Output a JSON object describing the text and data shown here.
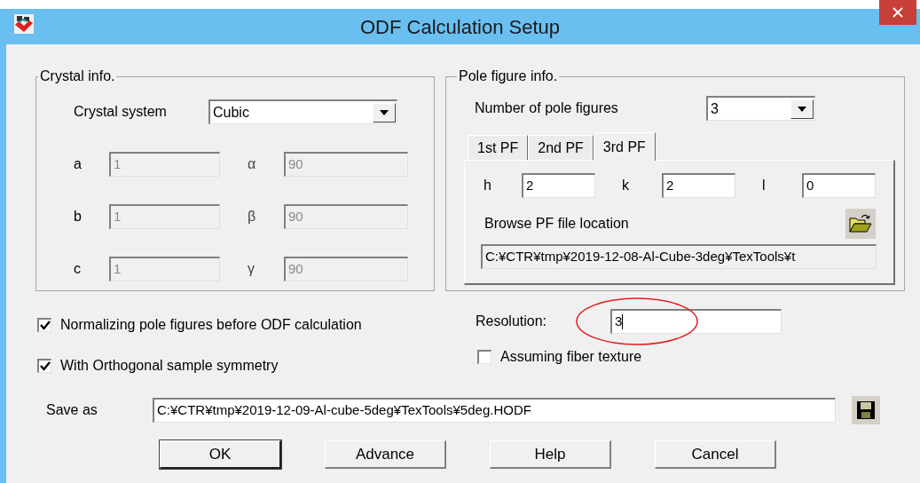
{
  "window": {
    "title": "ODF Calculation Setup"
  },
  "crystal_info": {
    "title": "Crystal info.",
    "crystal_system": {
      "label": "Crystal system",
      "value": "Cubic"
    },
    "parameters": [
      {
        "label": "a",
        "value": "1",
        "disabled": true
      },
      {
        "label": "α",
        "value": "90",
        "disabled": true
      },
      {
        "label": "b",
        "value": "1",
        "disabled": true
      },
      {
        "label": "β",
        "value": "90",
        "disabled": true
      },
      {
        "label": "c",
        "value": "1",
        "disabled": true
      },
      {
        "label": "γ",
        "value": "90",
        "disabled": true
      }
    ]
  },
  "pole_figure_info": {
    "title": "Pole figure info.",
    "count": {
      "label": "Number of pole figures",
      "value": "3"
    },
    "tabs": [
      {
        "label": "1st PF",
        "selected": false
      },
      {
        "label": "2nd PF",
        "selected": false
      },
      {
        "label": "3rd PF",
        "selected": true
      }
    ],
    "indices": [
      {
        "label": "h",
        "value": "2"
      },
      {
        "label": "k",
        "value": "2"
      },
      {
        "label": "l",
        "value": "0"
      }
    ],
    "browse_label": "Browse PF file location",
    "file_path": "C:¥CTR¥tmp¥2019-12-08-Al-Cube-3deg¥TexTools¥t"
  },
  "options": [
    {
      "label": "Normalizing pole figures before ODF calculation",
      "checked": true
    },
    {
      "label": "With Orthogonal sample symmetry",
      "checked": true
    }
  ],
  "resolution": {
    "label": "Resolution:",
    "value": "3"
  },
  "fiber_texture": {
    "label": "Assuming fiber texture",
    "checked": false
  },
  "save_as": {
    "label": "Save as",
    "value": "C:¥CTR¥tmp¥2019-12-09-Al-cube-5deg¥TexTools¥5deg.HODF"
  },
  "buttons": [
    {
      "label": "OK",
      "default": true
    },
    {
      "label": "Advance",
      "default": false
    },
    {
      "label": "Help",
      "default": false
    },
    {
      "label": "Cancel",
      "default": false
    }
  ]
}
